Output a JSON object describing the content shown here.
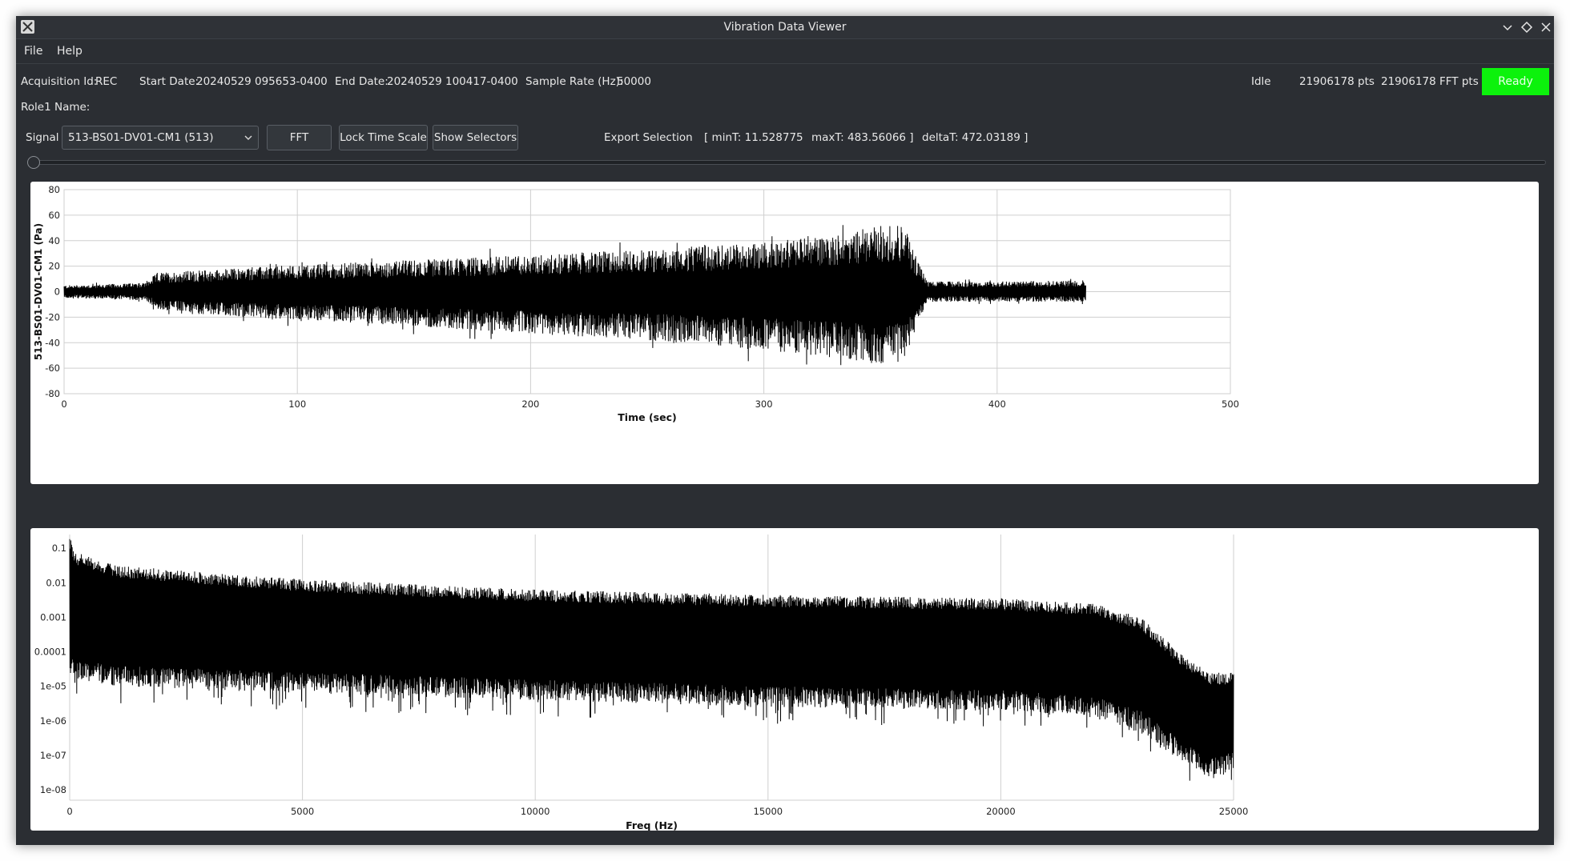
{
  "window": {
    "title": "Vibration Data Viewer"
  },
  "menu": [
    "File",
    "Help"
  ],
  "header": {
    "acq_label": "Acquisition Id:",
    "acq_value": "REC",
    "start_label": "Start Date:",
    "start_value": "20240529 095653-0400",
    "end_label": "End Date:",
    "end_value": "20240529 100417-0400",
    "rate_label": "Sample Rate (Hz):",
    "rate_value": "50000",
    "state": "Idle",
    "pts": "21906178 pts",
    "fft_pts": "21906178 FFT pts",
    "ready": "Ready",
    "ready_color": "#0cf20c",
    "role_label": "Role1 Name:"
  },
  "controls": {
    "signal_label": "Signal",
    "signal_value": "513-BS01-DV01-CM1  (513)",
    "fft_button": "FFT",
    "lock_button": "Lock Time Scale",
    "selectors_button": "Show Selectors",
    "export_label": "Export Selection",
    "selection": "[ minT: 11.528775     maxT: 483.56066 ]     deltaT: 472.03189 ]",
    "min_text": "[ minT: 11.528775",
    "max_text": "maxT: 483.56066 ]",
    "delta_text": "deltaT: 472.03189 ]"
  },
  "chart_data": [
    {
      "type": "line",
      "xlabel": "Time (sec)",
      "ylabel": "513-BS01-DV01-CM1 (Pa)",
      "xlim": [
        0,
        500
      ],
      "ylim": [
        -80,
        80
      ],
      "xticks": [
        "0",
        "100",
        "200",
        "300",
        "400",
        "500"
      ],
      "yticks": [
        "80",
        "60",
        "40",
        "20",
        "0",
        "-20",
        "-40",
        "-60",
        "-80"
      ],
      "grid": true,
      "envelope": {
        "x": [
          0,
          20,
          35,
          40,
          60,
          100,
          150,
          200,
          250,
          300,
          330,
          350,
          360,
          365,
          370,
          400,
          438
        ],
        "upper": [
          5,
          6,
          7,
          15,
          17,
          21,
          25,
          29,
          33,
          39,
          45,
          52,
          52,
          30,
          8,
          8,
          9
        ],
        "lower": [
          -5,
          -6,
          -7,
          -14,
          -18,
          -22,
          -27,
          -33,
          -38,
          -46,
          -52,
          -57,
          -55,
          -30,
          -8,
          -8,
          -8
        ]
      },
      "series": [
        {
          "values": []
        }
      ]
    },
    {
      "type": "line",
      "xlabel": "Freq (Hz)",
      "ylabel": "",
      "xlim": [
        0,
        25000
      ],
      "ylim": [
        "1e-08",
        "0.1"
      ],
      "log_y": true,
      "xticks": [
        "0",
        "5000",
        "10000",
        "15000",
        "20000",
        "25000"
      ],
      "yticks": [
        "0.1",
        "0.01",
        "0.001",
        "0.0001",
        "1e-05",
        "1e-06",
        "1e-07",
        "1e-08"
      ],
      "grid": true,
      "envelope": {
        "x": [
          0,
          100,
          1000,
          3000,
          5000,
          10000,
          15000,
          20000,
          22000,
          23000,
          24000,
          24500,
          25000
        ],
        "upper_log10": [
          -0.6,
          -1.1,
          -1.5,
          -1.7,
          -1.9,
          -2.2,
          -2.35,
          -2.45,
          -2.6,
          -3.0,
          -4.2,
          -4.6,
          -4.6
        ],
        "lower_log10": [
          -4.6,
          -4.8,
          -5.0,
          -5.1,
          -5.2,
          -5.4,
          -5.6,
          -5.7,
          -5.9,
          -6.3,
          -7.3,
          -7.7,
          -7.5
        ]
      },
      "series": [
        {
          "values": []
        }
      ]
    }
  ]
}
